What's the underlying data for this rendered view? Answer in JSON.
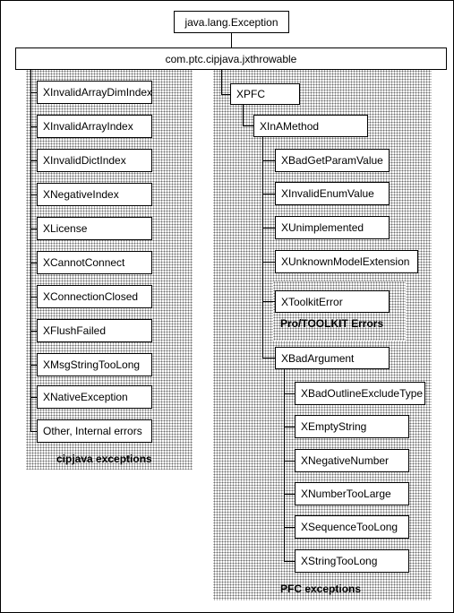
{
  "diagram": {
    "root": "java.lang.Exception",
    "throwable": "com.ptc.cipjava.jxthrowable",
    "cipjava": {
      "items": [
        "XInvalidArrayDimIndex",
        "XInvalidArrayIndex",
        "XInvalidDictIndex",
        "XNegativeIndex",
        "XLicense",
        "XCannotConnect",
        "XConnectionClosed",
        "XFlushFailed",
        "XMsgStringTooLong",
        "XNativeException",
        "Other, Internal errors"
      ],
      "caption": "cipjava exceptions"
    },
    "pfc": {
      "root": "XPFC",
      "in_a_method": "XInAMethod",
      "method_children": [
        "XBadGetParamValue",
        "XInvalidEnumValue",
        "XUnimplemented",
        "XUnknownModelExtension"
      ],
      "toolkit": {
        "label": "XToolkitError",
        "caption": "Pro/TOOLKIT Errors"
      },
      "bad_argument": "XBadArgument",
      "argument_children": [
        "XBadOutlineExcludeType",
        "XEmptyString",
        "XNegativeNumber",
        "XNumberTooLarge",
        "XSequenceTooLong",
        "XStringTooLong"
      ],
      "caption": "PFC exceptions"
    }
  }
}
